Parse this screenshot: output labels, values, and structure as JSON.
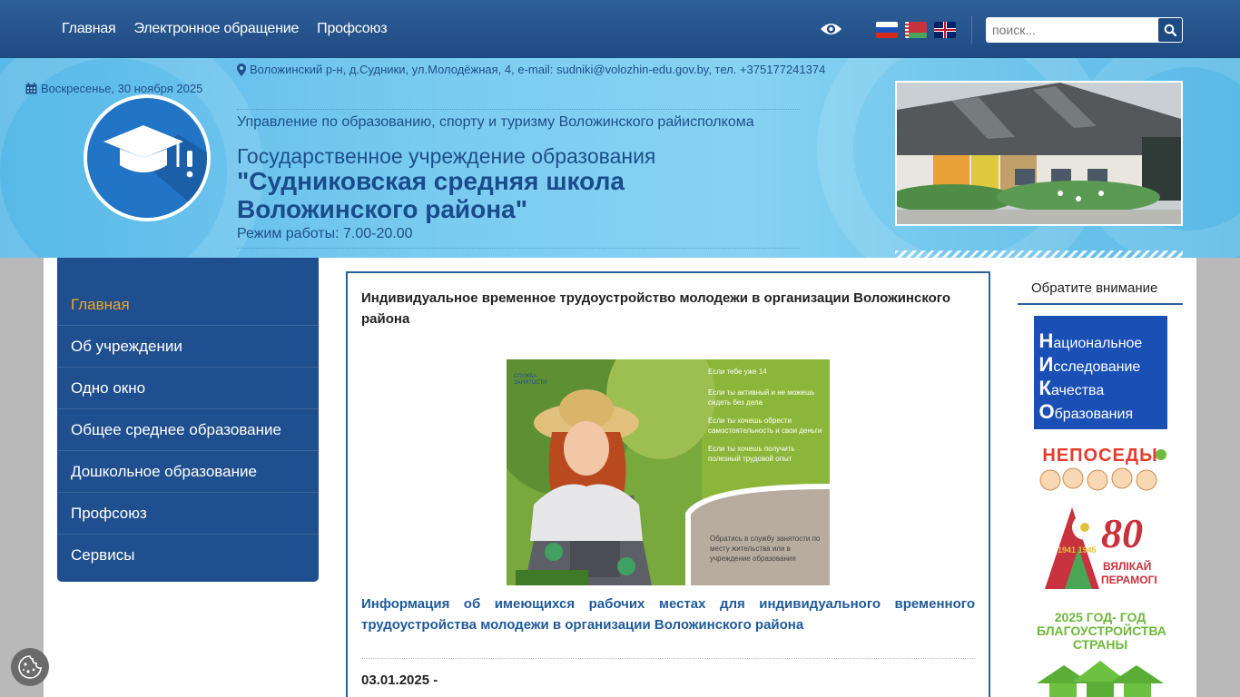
{
  "topbar": {
    "nav": [
      "Главная",
      "Электронное обращение",
      "Профсоюз"
    ],
    "search_placeholder": "поиск...",
    "icons": [
      "eye-icon",
      "flag-ru-icon",
      "flag-by-icon",
      "flag-en-icon",
      "search-icon"
    ]
  },
  "header": {
    "date": "Воскресенье, 30 ноября 2025",
    "address": "Воложинский р-н, д.Судники, ул.Молодёжная, 4, e-mail: sudniki@volozhin-edu.gov.by, тел. +375177241374",
    "ministry": "Управление по образованию, спорту и туризму Воложинского райисполкома",
    "institution_type": "Государственное учреждение образования",
    "institution_name": "\"Судниковская средняя школа Воложинского района\"",
    "hours": "Режим работы: 7.00-20.00"
  },
  "sidebar": {
    "items": [
      "Главная",
      "Об учреждении",
      "Одно окно",
      "Общее среднее образование",
      "Дошкольное образование",
      "Профсоюз",
      "Сервисы"
    ]
  },
  "article": {
    "title": "Индивидуальное временное трудоустройство молодежи в организации Воложинского района",
    "poster": {
      "brand": "СЛУЖБА ЗАНЯТОСТИ",
      "lines": [
        "Если тебе уже 14",
        "Если ты активный и не можешь сидеть без дела",
        "Если ты хочешь обрести самостоятельность и свои деньги",
        "Если ты хочешь получить полезный трудовой опыт"
      ],
      "footer": "Обратись в службу занятости по месту жительства или в учреждение образования"
    },
    "link": "Информация об имеющихся рабочих местах для  индивидуального временного трудоустройства молодежи в организации Воложинского района",
    "next_date": "03.01.2025 -"
  },
  "right": {
    "heading": "Обратите внимание",
    "niko": [
      "Н",
      "ациональное",
      "И",
      "сследование",
      "К",
      "ачества",
      "О",
      "бразования"
    ],
    "neposedy": "НЕПОСЕДЫ",
    "victory": {
      "years": "1941 1945",
      "number": "80",
      "text1": "ВЯЛІКАЙ",
      "text2": "ПЕРАМОГІ"
    },
    "year_banner": "2025 ГОД- ГОД БЛАГОУСТРОЙСТВА СТРАНЫ"
  },
  "colors": {
    "primary": "#1f4f8e",
    "accent": "#f5a623",
    "header_sky": "#7dcdf1",
    "link": "#1f5a99"
  }
}
